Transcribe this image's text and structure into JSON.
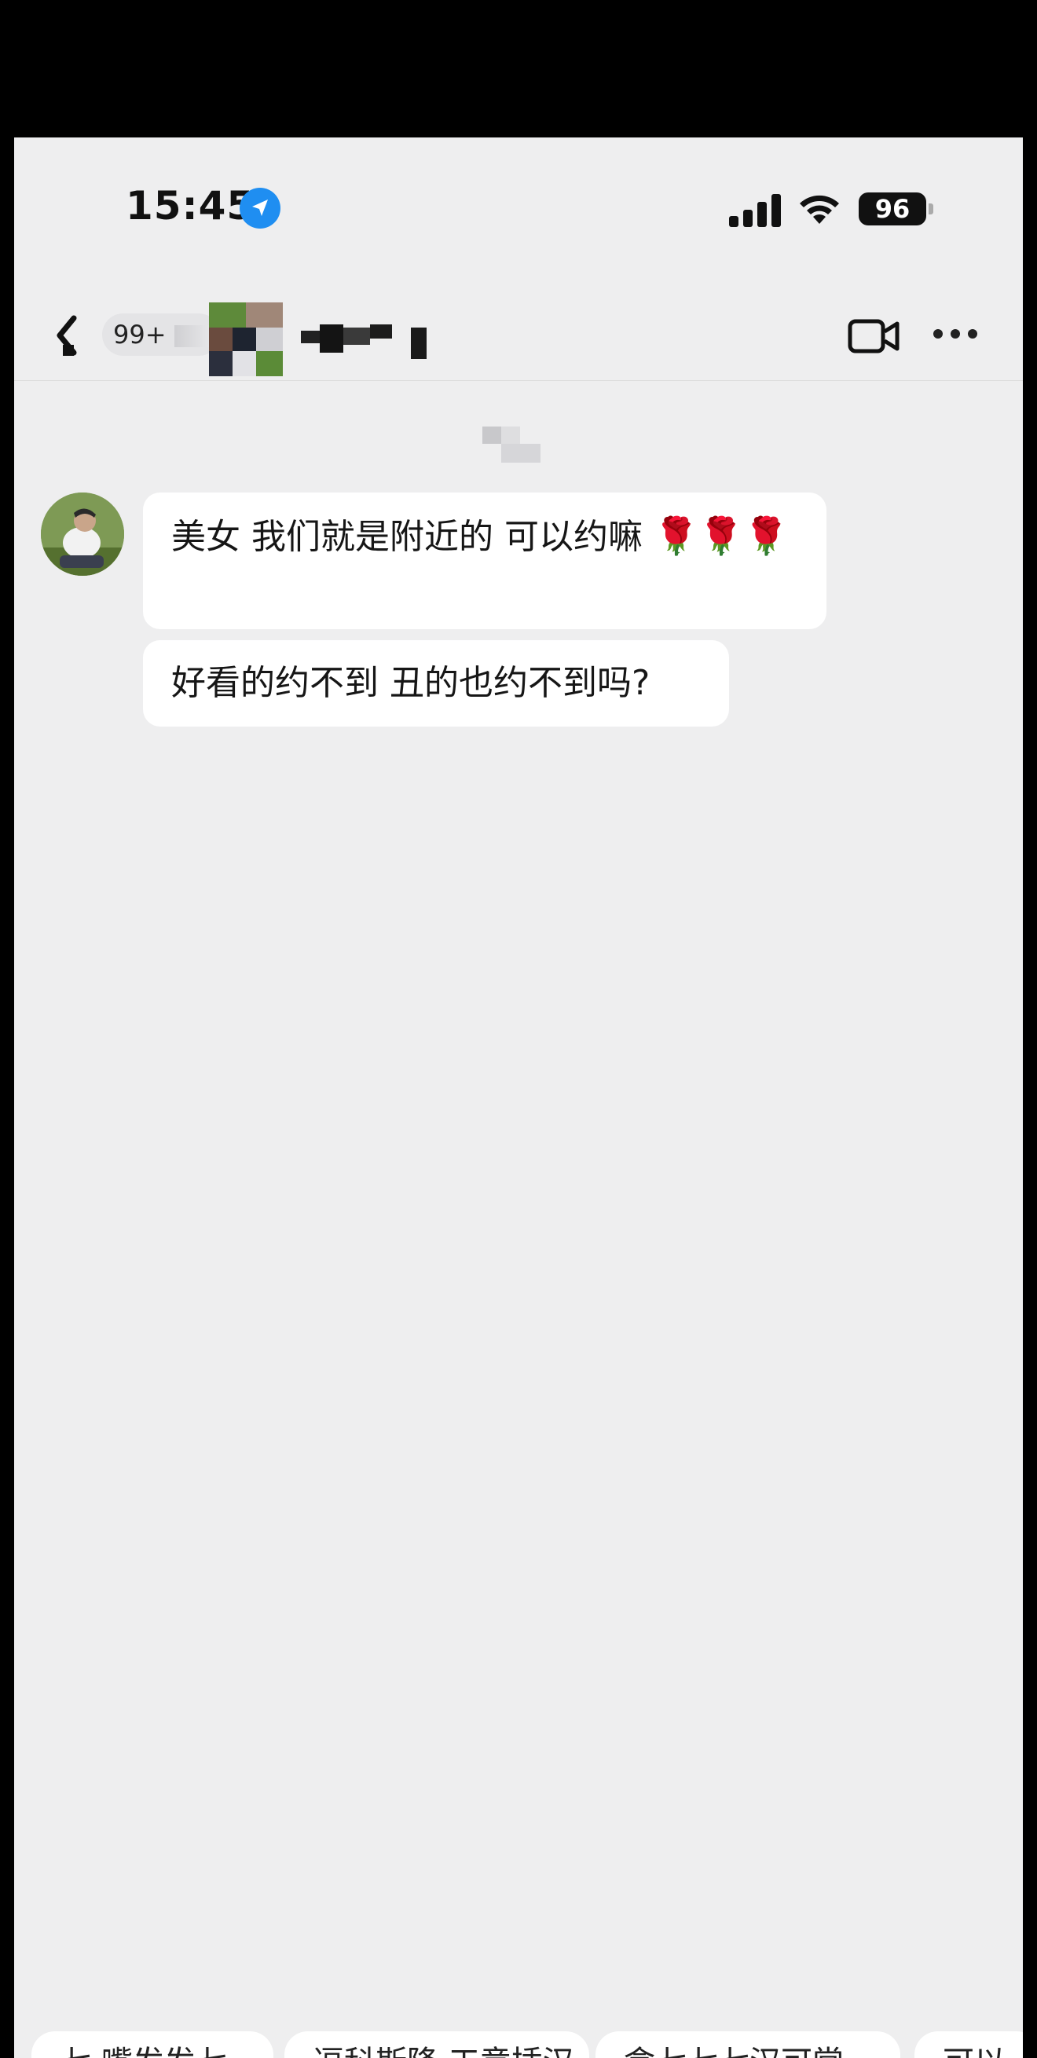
{
  "status_bar": {
    "time": "15:45",
    "battery": "96"
  },
  "nav": {
    "unread_count": "99+"
  },
  "messages": [
    {
      "text": "美女 我们就是附近的 可以约嘛",
      "emoji": "🌹🌹🌹"
    },
    {
      "text": "好看的约不到 丑的也约不到吗?"
    }
  ],
  "quick_replies": [
    "七 嘴发发七",
    "逗科斯降 工意插汉",
    "盒七七七汉可常",
    "可以"
  ],
  "colors": {
    "background": "#eeeeef",
    "bubble": "#ffffff",
    "accent_location": "#1f8ef1"
  }
}
